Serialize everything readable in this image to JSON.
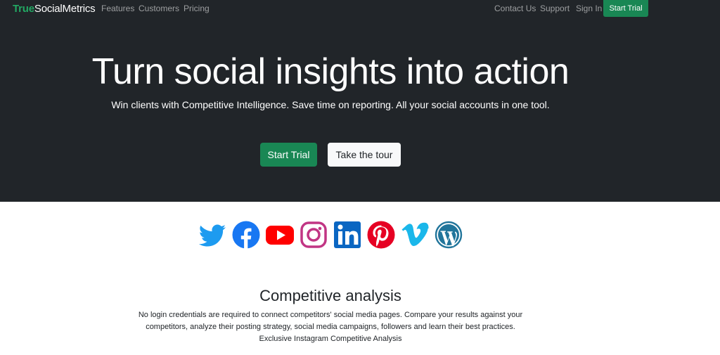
{
  "nav": {
    "brand_part1": "True",
    "brand_part2": "SocialMetrics",
    "left_links": [
      "Features",
      "Customers",
      "Pricing"
    ],
    "right_links": [
      "Contact Us",
      "Support",
      "Sign In"
    ],
    "cta_label": "Start Trial"
  },
  "hero": {
    "headline": "Turn social insights into action",
    "subheadline": "Win clients with Competitive Intelligence. Save time on reporting. All your social accounts in one tool.",
    "primary_button": "Start Trial",
    "secondary_button": "Take the tour"
  },
  "social_icons": [
    "twitter-icon",
    "facebook-icon",
    "youtube-icon",
    "instagram-icon",
    "linkedin-icon",
    "pinterest-icon",
    "vimeo-icon",
    "wordpress-icon"
  ],
  "colors": {
    "hero_background": "#212529",
    "brand_green": "#22a863",
    "button_green": "#198754",
    "twitter": "#1d9bf0",
    "facebook": "#1877f2",
    "youtube": "#ff0000",
    "instagram": "#c13584",
    "linkedin": "#0a66c2",
    "pinterest": "#e60023",
    "vimeo": "#1ab7ea",
    "wordpress": "#21759b"
  },
  "competitive": {
    "title": "Competitive analysis",
    "line1": "No login credentials are required to connect competitors' social media pages. Compare your results against your",
    "line2": "competitors, analyze their posting strategy, social media campaigns, followers and learn their best practices.",
    "line3": "Exclusive Instagram Competitive Analysis"
  }
}
